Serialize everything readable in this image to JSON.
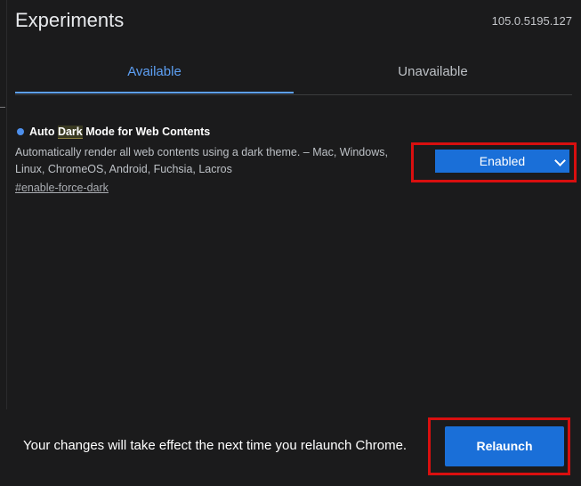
{
  "header": {
    "title": "Experiments",
    "version": "105.0.5195.127"
  },
  "tabs": [
    {
      "label": "Available",
      "active": true
    },
    {
      "label": "Unavailable",
      "active": false
    }
  ],
  "experiment": {
    "title_before": "Auto ",
    "title_highlight": "Dark",
    "title_after": " Mode for Web Contents",
    "description": "Automatically render all web contents using a dark theme. – Mac, Windows, Linux, ChromeOS, Android, Fuchsia, Lacros",
    "link": "#enable-force-dark",
    "selected_option": "Enabled"
  },
  "footer": {
    "message": "Your changes will take effect the next time you relaunch Chrome.",
    "relaunch_label": "Relaunch"
  },
  "colors": {
    "background": "#1b1b1c",
    "accent": "#1a6fd8",
    "tab_active": "#5da0f5",
    "annotation_red": "#d90f0f"
  },
  "icons": {
    "status_dot": "blue-dot-icon",
    "dropdown": "chevron-down-icon"
  }
}
